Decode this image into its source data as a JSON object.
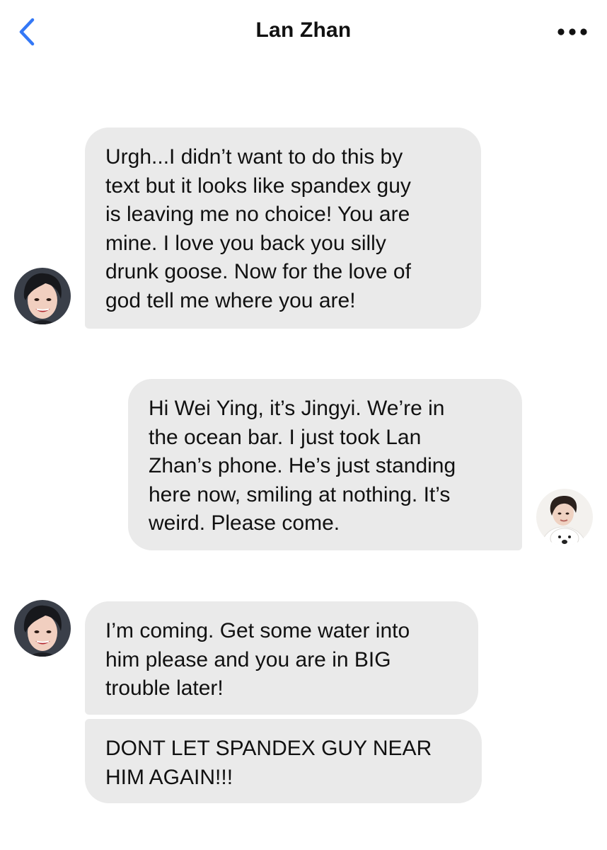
{
  "header": {
    "title": "Lan Zhan",
    "back_icon": "chevron-left-icon",
    "more_icon": "ellipsis-icon",
    "accent_color": "#3478f6"
  },
  "messages": [
    {
      "sender": "contact",
      "text": "Urgh...I didn’t want to do this by\ntext but it looks like spandex guy\nis leaving me no choice! You are\nmine. I love you back you silly\ndrunk goose. Now for the love of\ngod tell me where you are!"
    },
    {
      "sender": "me",
      "text": "Hi Wei Ying, it’s Jingyi. We’re in\nthe ocean bar. I just took Lan\nZhan’s phone. He’s just standing\nhere now, smiling at nothing. It’s\nweird. Please come."
    },
    {
      "sender": "contact",
      "text": "I’m coming. Get some water into\nhim please and you are in BIG\ntrouble later!"
    },
    {
      "sender": "contact",
      "text": "DONT LET SPANDEX GUY NEAR\nHIM AGAIN!!!"
    }
  ],
  "colors": {
    "bubble_background": "#eaeaea",
    "text": "#111111",
    "page_background": "#ffffff"
  }
}
